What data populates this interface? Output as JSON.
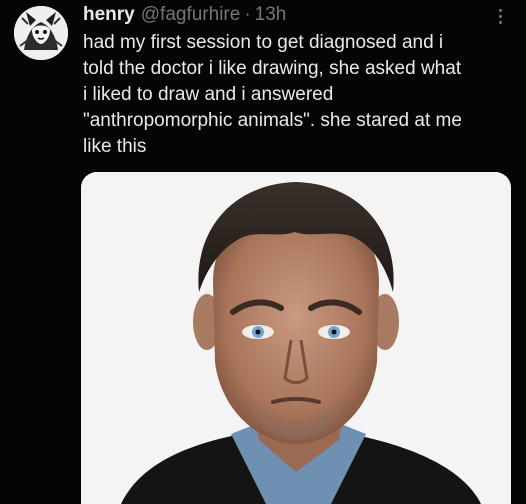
{
  "tweet": {
    "author": {
      "display_name": "henry",
      "handle": "@fagfurhire",
      "separator": "·",
      "timestamp": "13h",
      "avatar_icon": "avatar-illustration-icon"
    },
    "more_icon": "more-options-icon",
    "text_lines": [
      "had my first session to get diagnosed and i",
      "told the doctor i like drawing, she asked what",
      "i liked to draw and i answered",
      "\"anthropomorphic animals\". she stared at me",
      "like this"
    ],
    "media": {
      "kind": "photo",
      "background": "#f4f4f4"
    }
  },
  "colors": {
    "background": "#050505",
    "primary_text": "#e7e9ea",
    "secondary_text": "#71767b"
  }
}
